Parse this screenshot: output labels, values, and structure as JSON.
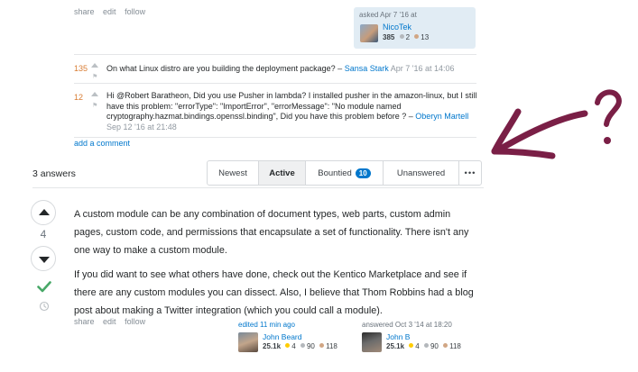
{
  "question": {
    "actions": [
      "share",
      "edit",
      "follow"
    ],
    "asker": {
      "label": "asked Apr 7 '16 at",
      "name": "NicoTek",
      "rep": "385",
      "silver": "2",
      "bronze": "13"
    }
  },
  "comments": [
    {
      "score": "135",
      "text": "On what Linux distro are you building the deployment package? –",
      "author": "Sansa Stark",
      "date": "Apr 7 '16 at 14:06"
    },
    {
      "score": "12",
      "text": "Hi @Robert Baratheon, Did you use Pusher in lambda? I installed pusher in the amazon-linux, but I still have this problem: \"errorType\": \"ImportError\",   \"errorMessage\": \"No module named cryptography.hazmat.bindings.openssl.binding\", Did you have this problem before ? –",
      "author": "Oberyn Martell",
      "date": "Sep 12 '16 at 21:48"
    }
  ],
  "add_comment": "add a comment",
  "answers_count": "3 answers",
  "sort_tabs": {
    "newest": "Newest",
    "active": "Active",
    "bountied": "Bountied",
    "bountied_count": "10",
    "unanswered": "Unanswered",
    "more": "•••"
  },
  "answer": {
    "votes": "4",
    "paragraphs": [
      "A custom module can be any combination of document types, web parts, custom admin pages, custom code, and permissions that encapsulate a set of functionality. There isn't any one way to make a custom module.",
      "If you did want to see what others have done, check out the Kentico Marketplace and see if there are any custom modules you can dissect. Also, I believe that Thom Robbins had a blog post about making a Twitter integration (which you could call a module)."
    ],
    "actions": [
      "share",
      "edit",
      "follow"
    ],
    "editor": {
      "label": "edited 11 min ago",
      "name": "John Beard",
      "rep": "25.1k",
      "gold": "4",
      "silver": "90",
      "bronze": "118"
    },
    "answerer": {
      "label": "answered Oct 3 '14 at 18:20",
      "name": "John B",
      "rep": "25.1k",
      "gold": "4",
      "silver": "90",
      "bronze": "118"
    }
  },
  "colors": {
    "link": "#0077cc",
    "accepted": "#48a868",
    "annotation": "#7a1f46",
    "comment_score": "#d87c33"
  }
}
